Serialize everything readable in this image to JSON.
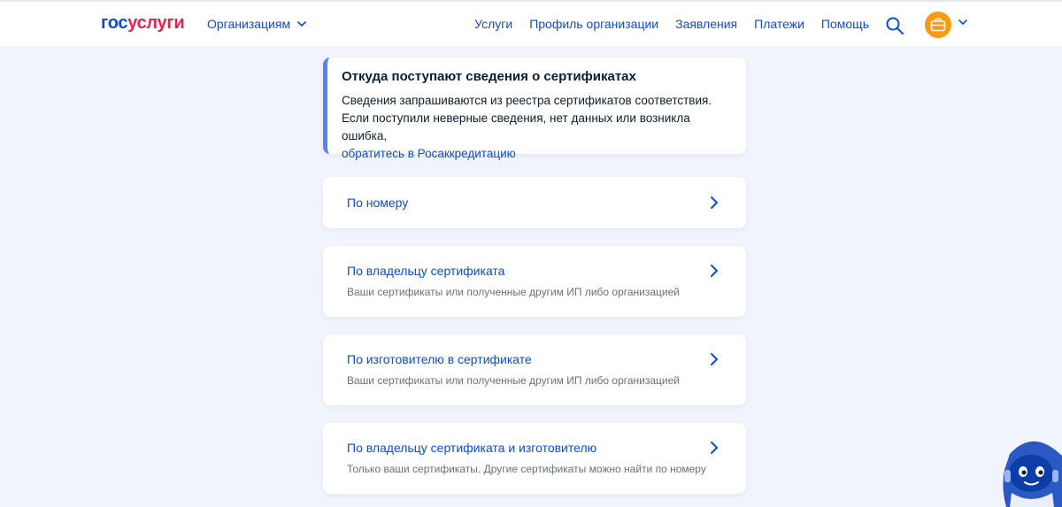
{
  "header": {
    "logo_part1": "гос",
    "logo_part2": "услуги",
    "org_menu_label": "Организациям",
    "nav": [
      {
        "label": "Услуги"
      },
      {
        "label": "Профиль организации"
      },
      {
        "label": "Заявления"
      },
      {
        "label": "Платежи"
      },
      {
        "label": "Помощь"
      }
    ],
    "icons": {
      "search": "search-icon",
      "avatar": "briefcase-icon",
      "dropdown": "chevron-down-icon"
    }
  },
  "info": {
    "title": "Откуда поступают сведения о сертификатах",
    "text": "Сведения запрашиваются из реестра сертификатов соответствия. Если поступили неверные сведения, нет данных или возникла ошибка,",
    "link": "обратитесь в Росаккредитацию"
  },
  "options": [
    {
      "title": "По номеру",
      "subtitle": ""
    },
    {
      "title": "По владельцу сертификата",
      "subtitle": "Ваши сертификаты или полученные другим ИП либо организацией"
    },
    {
      "title": "По изготовителю в сертификате",
      "subtitle": "Ваши сертификаты или полученные другим ИП либо организацией"
    },
    {
      "title": "По владельцу сертификата и изготовителю",
      "subtitle": "Только ваши сертификаты. Другие сертификаты можно найти по номеру"
    }
  ],
  "colors": {
    "brand_blue": "#0d4cd3",
    "brand_red": "#e4234d",
    "accent_orange": "#f89a13",
    "background": "#f1f4fb"
  }
}
